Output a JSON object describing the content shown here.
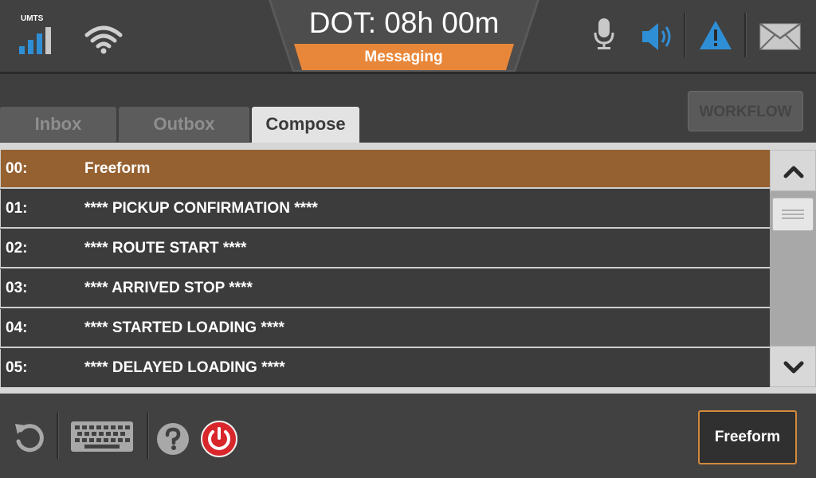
{
  "status": {
    "network_label": "UMTS",
    "signal_level": 3,
    "signal_max": 4,
    "wifi_icon": "wifi-icon"
  },
  "header": {
    "title": "DOT: 08h 00m",
    "subtitle": "Messaging",
    "accent_color": "#e8873a"
  },
  "header_icons": [
    "microphone-icon",
    "speaker-icon",
    "alert-icon",
    "mail-icon"
  ],
  "tabs": [
    {
      "label": "Inbox",
      "active": false
    },
    {
      "label": "Outbox",
      "active": false
    },
    {
      "label": "Compose",
      "active": true
    }
  ],
  "workflow_button": "WORKFLOW",
  "messages": [
    {
      "num": "00:",
      "text": "Freeform",
      "selected": true
    },
    {
      "num": "01:",
      "text": "**** PICKUP CONFIRMATION ****",
      "selected": false
    },
    {
      "num": "02:",
      "text": "**** ROUTE START ****",
      "selected": false
    },
    {
      "num": "03:",
      "text": "**** ARRIVED STOP ****",
      "selected": false
    },
    {
      "num": "04:",
      "text": "**** STARTED LOADING ****",
      "selected": false
    },
    {
      "num": "05:",
      "text": "**** DELAYED LOADING ****",
      "selected": false
    }
  ],
  "footer": {
    "icons": [
      "refresh-icon",
      "keyboard-icon",
      "help-icon",
      "power-icon"
    ],
    "action_button": "Freeform"
  },
  "colors": {
    "selected_row": "#966131",
    "blue_icon": "#2f8fd6",
    "power_red": "#d8262b"
  }
}
